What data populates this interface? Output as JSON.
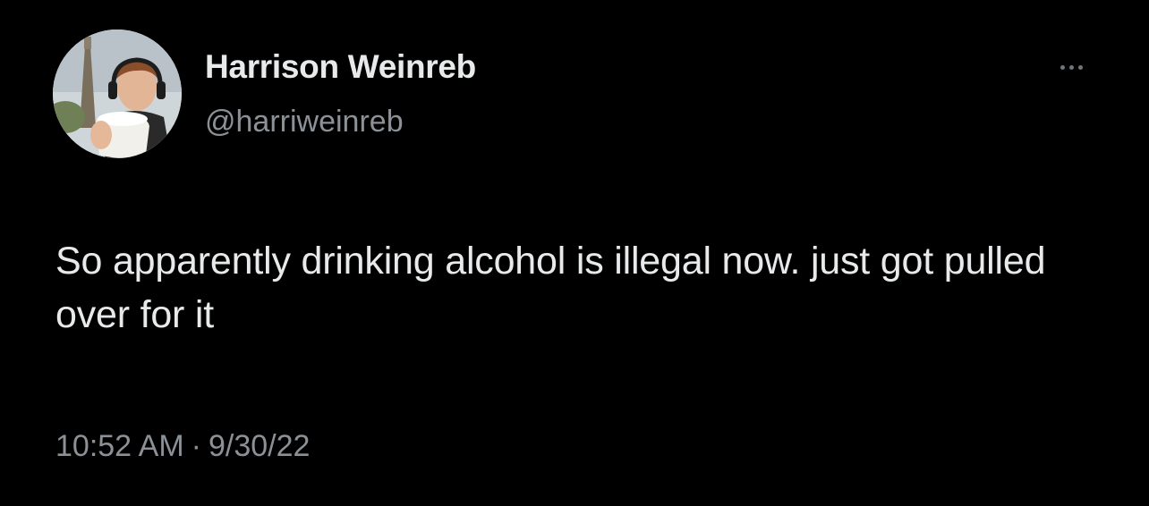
{
  "tweet": {
    "author": {
      "display_name": "Harrison Weinreb",
      "handle": "@harriweinreb",
      "avatar_icon": "profile-photo"
    },
    "text": "So apparently drinking alcohol is illegal now. just got pulled over for it",
    "time": "10:52 AM",
    "separator": "·",
    "date": "9/30/22",
    "more_icon": "ellipsis-icon"
  },
  "colors": {
    "background": "#000000",
    "primary_text": "#e7e9ea",
    "secondary_text": "#8b9196"
  }
}
